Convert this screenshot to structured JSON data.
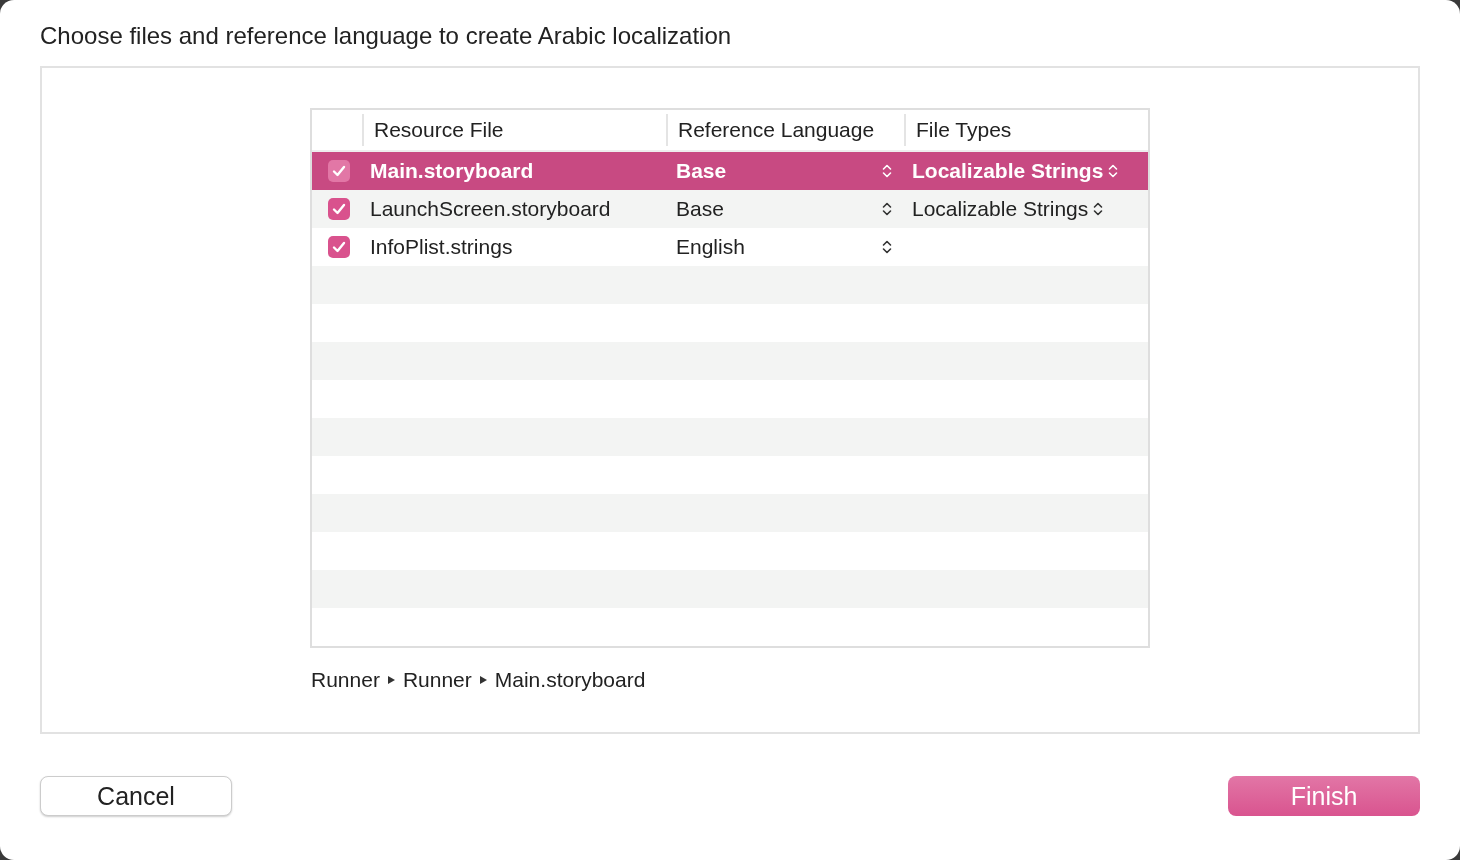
{
  "dialog": {
    "title": "Choose files and reference language to create Arabic localization"
  },
  "table": {
    "columns": [
      "Resource File",
      "Reference Language",
      "File Types"
    ],
    "rows": [
      {
        "file": "Main.storyboard",
        "checked": true,
        "selected": true,
        "language": "Base",
        "file_type": "Localizable Strings"
      },
      {
        "file": "LaunchScreen.storyboard",
        "checked": true,
        "selected": false,
        "language": "Base",
        "file_type": "Localizable Strings"
      },
      {
        "file": "InfoPlist.strings",
        "checked": true,
        "selected": false,
        "language": "English"
      }
    ]
  },
  "path": [
    "Runner",
    "Runner",
    "Main.storyboard"
  ],
  "buttons": [
    {
      "label": "Cancel",
      "default": false
    },
    {
      "label": "Finish",
      "default": true
    }
  ]
}
